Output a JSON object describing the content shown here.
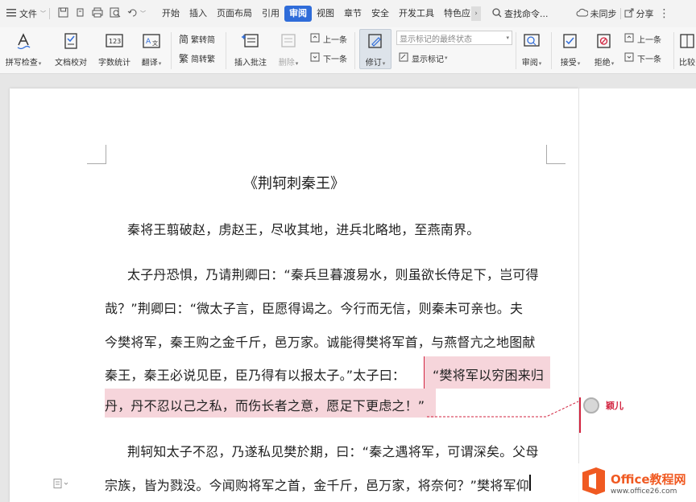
{
  "menubar": {
    "file_label": "文件",
    "tabs": [
      "开始",
      "插入",
      "页面布局",
      "引用",
      "审阅",
      "视图",
      "章节",
      "安全",
      "开发工具",
      "特色应"
    ],
    "active_tab": "审阅",
    "search_label": "查找命令...",
    "sync_label": "未同步",
    "share_label": "分享"
  },
  "ribbon": {
    "spell_check": "拼写检查",
    "doc_proofread": "文档校对",
    "word_count": "字数统计",
    "translate": "翻译",
    "to_traditional": "繁转简",
    "to_simplified": "简转繁",
    "insert_comment": "插入批注",
    "delete": "删除",
    "prev_comment": "上一条",
    "next_comment": "下一条",
    "track_changes": "修订",
    "display_mode": "显示标记的最终状态",
    "show_markup": "显示标记",
    "review": "审阅",
    "accept": "接受",
    "reject": "拒绝",
    "prev_change": "上一条",
    "next_change": "下一条",
    "compare": "比较"
  },
  "document": {
    "title": "《荆轲刺秦王》",
    "lines": [
      "秦将王翦破赵，虏赵王，尽收其地，进兵北略地，至燕南界。",
      "太子丹恐惧，乃请荆卿曰：“秦兵旦暮渡易水，则虽欲长侍足下，岂可得",
      "哉？”荆卿曰：“微太子言，臣愿得谒之。今行而无信，则秦未可亲也。夫",
      "今樊将军，秦王购之金千斤，邑万家。诚能得樊将军首，与燕督亢之地图献",
      "秦王，秦王必说见臣，臣乃得有以报太子。”太子曰：",
      "“樊将军以穷困来归",
      "丹，丹不忍以己之私，而伤长者之意，愿足下更虑之！”",
      "荆轲知太子不忍，乃遂私见樊於期，曰：“秦之遇将军，可谓深矣。父母",
      "宗族，皆为戮没。今闻购将军之首，金千斤，邑万家，将奈何？”樊将军仰"
    ]
  },
  "comment": {
    "author": "颖儿"
  },
  "watermark": {
    "brand": "Office教程网",
    "url": "www.office26.com"
  },
  "colors": {
    "accent": "#2f6cd9",
    "highlight": "#f6d5db",
    "comment_author": "#d2233f",
    "logo_orange": "#f05a22"
  }
}
